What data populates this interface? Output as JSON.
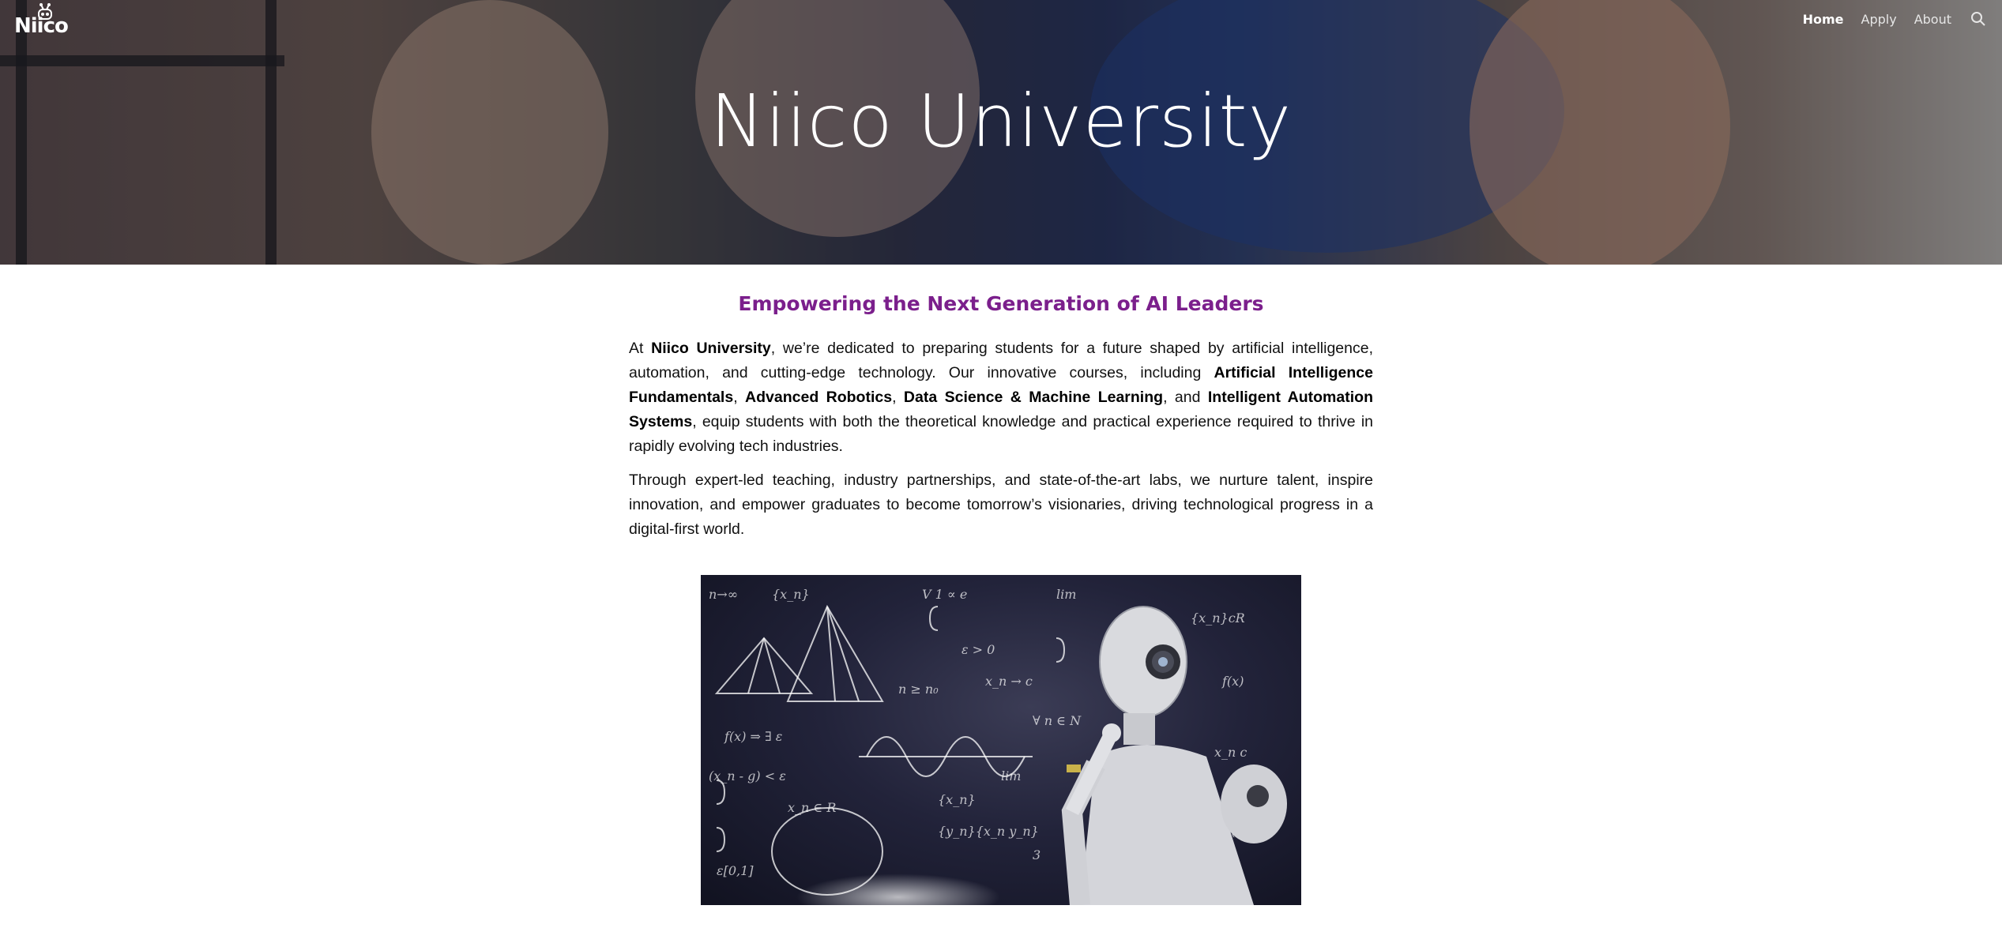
{
  "site": {
    "logo_text": "Niico",
    "hero_title": "Niico University"
  },
  "nav": {
    "items": [
      {
        "label": "Home",
        "active": true
      },
      {
        "label": "Apply",
        "active": false
      },
      {
        "label": "About",
        "active": false
      }
    ],
    "search_icon": "search-icon"
  },
  "main": {
    "headline": "Empowering the Next Generation of AI Leaders",
    "paragraph1": {
      "t1": "At ",
      "b1": "Niico University",
      "t2": ", we’re dedicated to preparing students for a future shaped by artificial intelligence, automation, and cutting-edge technology. Our innovative courses, including ",
      "b2": "Artificial Intelligence Fundamentals",
      "t3": ", ",
      "b3": "Advanced Robotics",
      "t4": ", ",
      "b4": "Data Science & Machine Learning",
      "t5": ", and ",
      "b5": "Intelligent Automation Systems",
      "t6": ", equip students with both the theoretical knowledge and practical experience required to thrive in rapidly evolving tech industries."
    },
    "paragraph2": "Through expert-led teaching, industry partnerships, and state-of-the-art labs, we nurture talent, inspire innovation, and empower graduates to become tomorrow’s visionaries, driving technological progress in a digital-first world."
  },
  "colors": {
    "headline": "#7b1f8c",
    "nav_text": "#ffffff",
    "body_text": "#111111"
  }
}
